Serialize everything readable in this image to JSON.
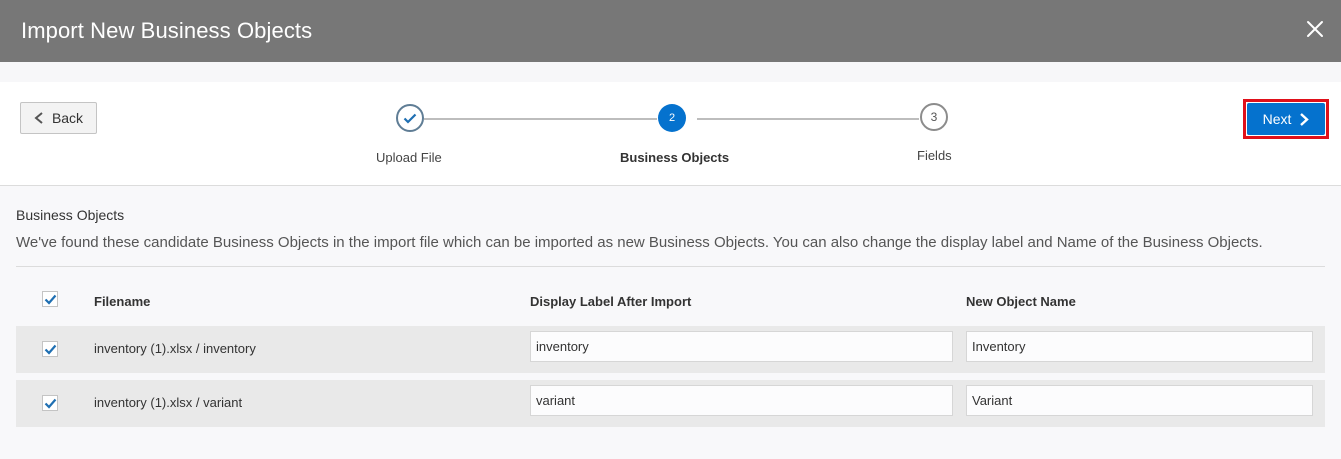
{
  "dialog": {
    "title": "Import New Business Objects",
    "close_icon": "close-icon"
  },
  "nav": {
    "back_label": "Back",
    "next_label": "Next",
    "back_icon": "chevron-left-icon",
    "next_icon": "chevron-right-icon"
  },
  "steps": [
    {
      "number": "1",
      "label": "Upload File",
      "state": "completed",
      "icon": "checkmark-icon"
    },
    {
      "number": "2",
      "label": "Business Objects",
      "state": "active"
    },
    {
      "number": "3",
      "label": "Fields",
      "state": "pending"
    }
  ],
  "section": {
    "title": "Business Objects",
    "description": "We've found these candidate Business Objects in the import file which can be imported as new Business Objects. You can also change the display label and Name of the Business Objects."
  },
  "table": {
    "headers": {
      "filename": "Filename",
      "display_label": "Display Label After Import",
      "object_name": "New Object Name"
    },
    "select_all_checked": true,
    "rows": [
      {
        "checked": true,
        "filename": "inventory (1).xlsx / inventory",
        "display_label": "inventory",
        "object_name": "Inventory"
      },
      {
        "checked": true,
        "filename": "inventory (1).xlsx / variant",
        "display_label": "variant",
        "object_name": "Variant"
      }
    ]
  },
  "colors": {
    "title_bar": "#777777",
    "accent": "#0572ce",
    "highlight_outline": "#e0101a"
  }
}
